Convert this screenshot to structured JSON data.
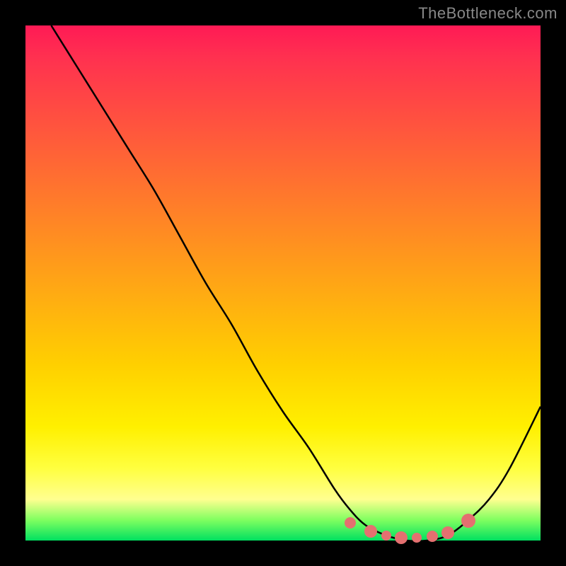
{
  "watermark": "TheBottleneck.com",
  "chart_data": {
    "type": "line",
    "title": "",
    "xlabel": "",
    "ylabel": "",
    "xlim": [
      0,
      100
    ],
    "ylim": [
      0,
      100
    ],
    "grid": false,
    "background": "rainbow-gradient-vertical",
    "series": [
      {
        "name": "bottleneck-curve",
        "x": [
          5,
          10,
          15,
          20,
          25,
          30,
          35,
          40,
          45,
          50,
          55,
          60,
          63,
          66,
          70,
          74,
          78,
          82,
          86,
          90,
          94,
          100
        ],
        "y": [
          100,
          92,
          84,
          76,
          68,
          59,
          50,
          42,
          33,
          25,
          18,
          10,
          6,
          3,
          1,
          0,
          0,
          1,
          4,
          8,
          14,
          26
        ]
      }
    ],
    "highlight_points": {
      "name": "optimal-range-dots",
      "color": "#e47070",
      "points": [
        {
          "x": 63,
          "y": 3.5,
          "r": 8
        },
        {
          "x": 67,
          "y": 1.8,
          "r": 9
        },
        {
          "x": 70,
          "y": 1.0,
          "r": 7
        },
        {
          "x": 73,
          "y": 0.6,
          "r": 9
        },
        {
          "x": 76,
          "y": 0.5,
          "r": 7
        },
        {
          "x": 79,
          "y": 0.8,
          "r": 8
        },
        {
          "x": 82,
          "y": 1.5,
          "r": 9
        },
        {
          "x": 86,
          "y": 3.8,
          "r": 10
        }
      ]
    },
    "annotations": [
      {
        "text": "TheBottleneck.com",
        "position": "top-right"
      }
    ]
  }
}
